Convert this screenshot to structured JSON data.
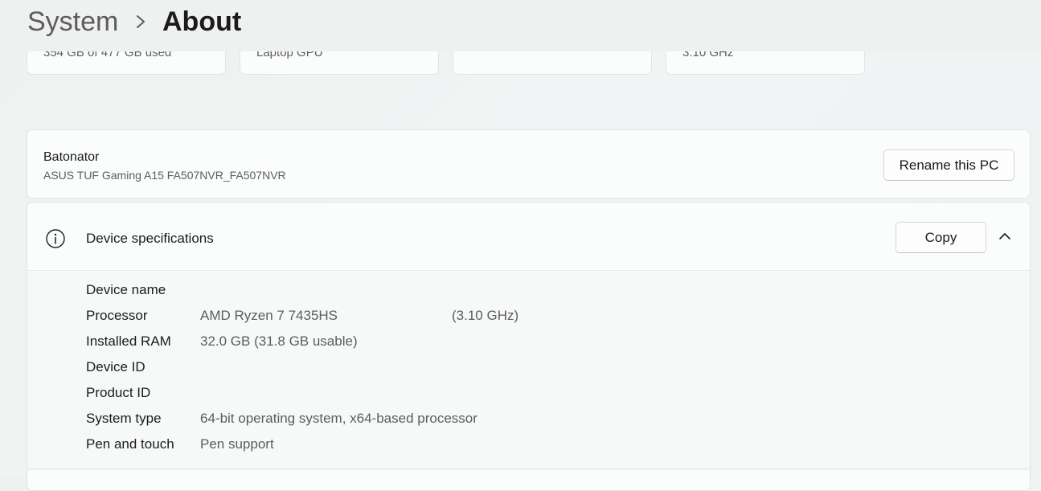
{
  "breadcrumb": {
    "parent": "System",
    "current": "About"
  },
  "top_tiles": [
    {
      "text": "354 GB of 477 GB used"
    },
    {
      "text": "Laptop GPU"
    },
    {
      "text": ""
    },
    {
      "text": "3.10 GHz"
    }
  ],
  "pc": {
    "name": "Batonator",
    "model": "ASUS TUF Gaming A15 FA507NVR_FA507NVR",
    "rename_label": "Rename this PC"
  },
  "device_specs": {
    "title": "Device specifications",
    "copy_label": "Copy",
    "rows": [
      {
        "label": "Device name",
        "value": "",
        "extra": ""
      },
      {
        "label": "Processor",
        "value": "AMD Ryzen 7 7435HS",
        "extra": "(3.10 GHz)"
      },
      {
        "label": "Installed RAM",
        "value": "32.0 GB (31.8 GB usable)",
        "extra": ""
      },
      {
        "label": "Device ID",
        "value": "",
        "extra": ""
      },
      {
        "label": "Product ID",
        "value": "",
        "extra": ""
      },
      {
        "label": "System type",
        "value": "64-bit operating system, x64-based processor",
        "extra": ""
      },
      {
        "label": "Pen and touch",
        "value": "Pen support",
        "extra": ""
      }
    ]
  },
  "colors": {
    "background": "#eef1ef",
    "card": "#fbfcfc",
    "text_primary": "#1b1b1b",
    "text_secondary": "#5c5c5c",
    "border": "#e2e4e4"
  }
}
